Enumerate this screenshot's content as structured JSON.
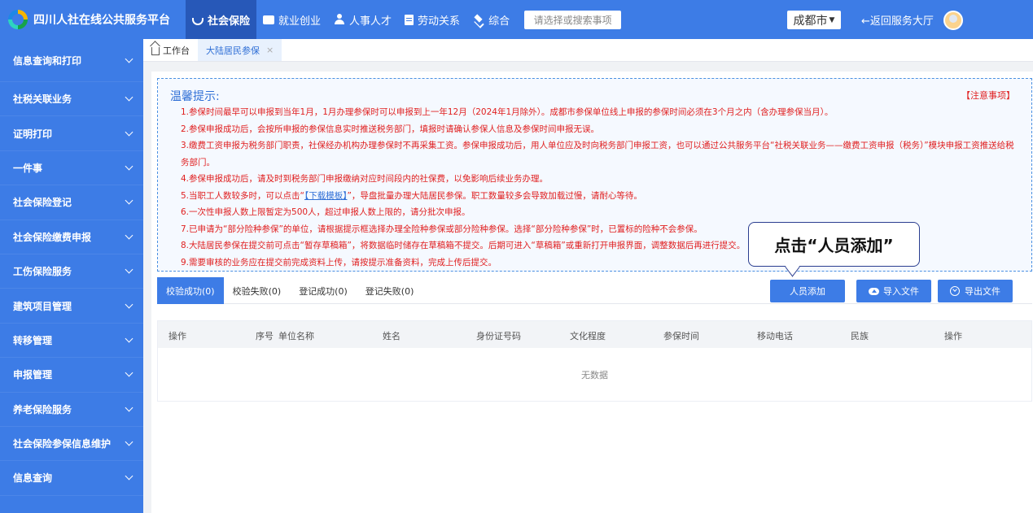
{
  "header": {
    "logo_text": "四川人社在线公共服务平台",
    "nav": [
      {
        "label": "社会保险",
        "icon": "hand-heart-icon",
        "active": true
      },
      {
        "label": "就业创业",
        "icon": "briefcase-icon"
      },
      {
        "label": "人事人才",
        "icon": "people-icon"
      },
      {
        "label": "劳动关系",
        "icon": "document-icon"
      },
      {
        "label": "综合",
        "icon": "layers-icon"
      }
    ],
    "search_placeholder": "请选择或搜索事项",
    "city": "成都市",
    "back_label": "←返回服务大厅"
  },
  "sidebar": {
    "items": [
      {
        "label": "信息查询和打印"
      },
      {
        "label": "社税关联业务"
      },
      {
        "label": "证明打印"
      },
      {
        "label": "一件事"
      },
      {
        "label": "社会保险登记"
      },
      {
        "label": "社会保险缴费申报"
      },
      {
        "label": "工伤保险服务"
      },
      {
        "label": "建筑项目管理"
      },
      {
        "label": "转移管理"
      },
      {
        "label": "申报管理"
      },
      {
        "label": "养老保险服务"
      },
      {
        "label": "社会保险参保信息维护"
      },
      {
        "label": "信息查询"
      }
    ]
  },
  "tabs": {
    "home": "工作台",
    "current": "大陆居民参保",
    "close": "×"
  },
  "notice": {
    "title": "温馨提示:",
    "link": "【注意事项】",
    "items": [
      "1.参保时间最早可以申报到当年1月，1月办理参保时可以申报到上一年12月（2024年1月除外）。成都市参保单位线上申报的参保时间必须在3个月之内（含办理参保当月）。",
      "2.参保申报成功后，会按所申报的参保信息实时推送税务部门，填报时请确认参保人信息及参保时间申报无误。",
      "3.缴费工资申报为税务部门职责，社保经办机构办理参保时不再采集工资。参保申报成功后，用人单位应及时向税务部门申报工资，也可以通过公共服务平台“社税关联业务——缴费工资申报（税务）”模块申报工资推送给税务部门。",
      "4.参保申报成功后，请及时到税务部门申报缴纳对应时间段内的社保费，以免影响后续业务办理。",
      "6.一次性申报人数上限暂定为500人，超过申报人数上限的，请分批次申报。",
      "7.已申请为“部分险种参保”的单位，请根据提示框选择办理全险种参保或部分险种参保。选择“部分险种参保”时，已置标的险种不会参保。",
      "8.大陆居民参保在提交前可点击“暂存草稿箱”，将数据临时储存在草稿箱不提交。后期可进入“草稿箱”或重新打开申报界面，调整数据后再进行提交。",
      "9.需要审核的业务应在提交前完成资料上传，请按提示准备资料，完成上传后提交。"
    ],
    "item5_prefix": "5.当职工人数较多时，可以点击“",
    "item5_link": "【下载模板】",
    "item5_suffix": "”，导盘批量办理大陆居民参保。职工数量较多会导致加载过慢，请耐心等待。"
  },
  "callout": "点击“人员添加”",
  "subtabs": [
    {
      "label": "校验成功(0)",
      "active": true
    },
    {
      "label": "校验失败(0)"
    },
    {
      "label": "登记成功(0)"
    },
    {
      "label": "登记失败(0)"
    }
  ],
  "buttons": {
    "add": "人员添加",
    "import": "导入文件",
    "export": "导出文件"
  },
  "table": {
    "columns": [
      "操作",
      "序号",
      "单位名称",
      "姓名",
      "身份证号码",
      "文化程度",
      "参保时间",
      "移动电话",
      "民族",
      "操作"
    ],
    "empty_text": "无数据"
  },
  "colors": {
    "primary": "#3d7ce6",
    "nav_active": "#2758b8",
    "notice_text": "#e02020",
    "link": "#2f6fd6"
  }
}
